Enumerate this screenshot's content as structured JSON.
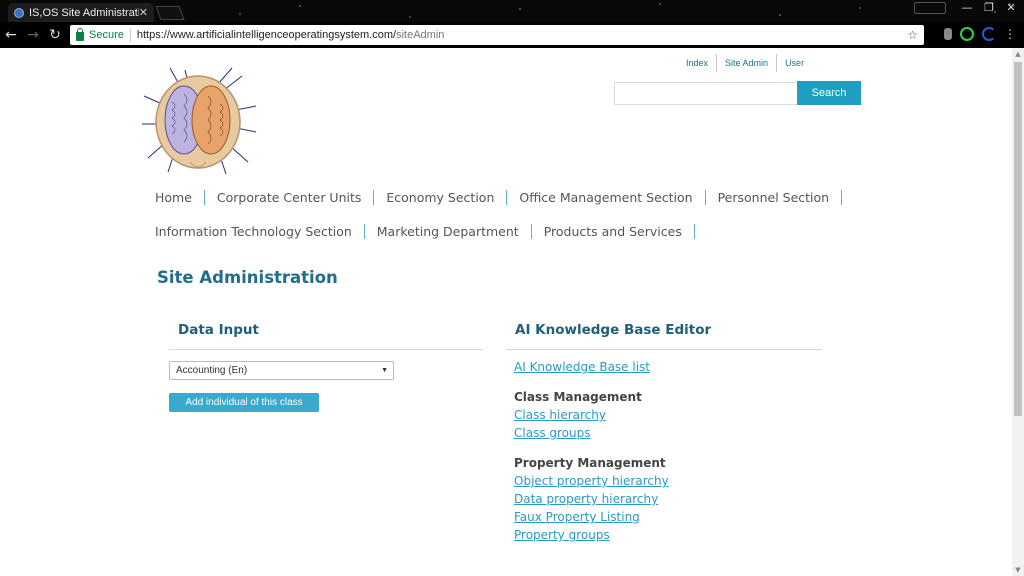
{
  "browser": {
    "tab_title": "IS,OS Site Administration",
    "tab_close": "✕",
    "secure_label": "Secure",
    "url_base": "https://www.artificialintelligenceoperatingsystem.com/",
    "url_path": "siteAdmin",
    "window_controls": [
      "—",
      "❐",
      "✕"
    ],
    "icons": [
      "back-icon",
      "forward-icon",
      "reload-icon",
      "lock-icon",
      "star-icon",
      "menu-icon"
    ]
  },
  "header": {
    "top_links": [
      "Index",
      "Site Admin",
      "User"
    ],
    "search_placeholder": "",
    "search_button": "Search"
  },
  "nav": {
    "row1": [
      "Home",
      "Corporate Center Units",
      "Economy Section",
      "Office Management Section",
      "Personnel Section"
    ],
    "row2": [
      "Information Technology Section",
      "Marketing Department",
      "Products and Services"
    ]
  },
  "main": {
    "page_title": "Site Administration",
    "data_input": {
      "title": "Data Input",
      "select_value": "Accounting (En)",
      "add_button": "Add individual of this class"
    },
    "kb_editor": {
      "title": "AI Knowledge Base Editor",
      "list_link": "AI Knowledge Base list",
      "class_heading": "Class Management",
      "class_links": [
        "Class hierarchy",
        "Class groups"
      ],
      "property_heading": "Property Management",
      "property_links": [
        "Object property hierarchy",
        "Data property hierarchy",
        "Faux Property Listing",
        "Property groups"
      ]
    }
  },
  "colors": {
    "accent": "#1f9ec2",
    "title": "#1f6f8b",
    "link": "#2a9ac0",
    "secure": "#0b8043"
  }
}
